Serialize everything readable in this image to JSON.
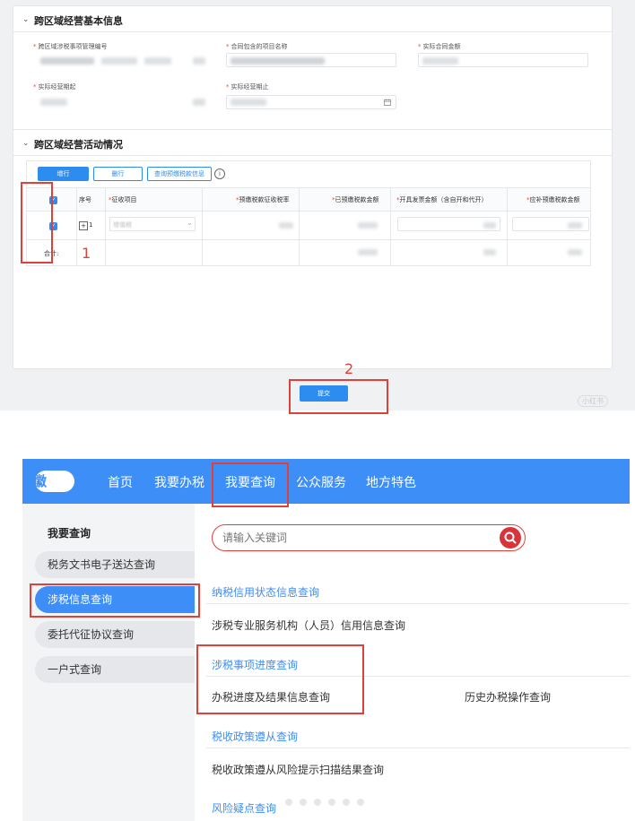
{
  "form": {
    "section1_title": "跨区域经营基本信息",
    "fields": [
      {
        "label": "跨区域涉税事项管理编号",
        "required": true
      },
      {
        "label": "合同包含的项目名称",
        "required": true
      },
      {
        "label": "实际合同金额",
        "required": true
      },
      {
        "label": "实际经营期起",
        "required": true
      },
      {
        "label": "实际经营期止",
        "required": true
      }
    ],
    "section2_title": "跨区域经营活动情况",
    "toolbar": {
      "add_row": "增行",
      "delete_row": "删行",
      "query_prepaid": "查询预缴税款信息"
    },
    "table": {
      "headers": [
        "序号",
        "征收项目",
        "预缴税款征收税率",
        "已预缴税款金额",
        "开具发票金额（含自开和代开）",
        "应补预缴税款金额"
      ],
      "row1": {
        "index": "1",
        "item_placeholder": "增值税"
      },
      "total_label": "合计:"
    },
    "submit": "提交",
    "annotation_1": "1",
    "annotation_2": "2",
    "watermark": "小红书"
  },
  "portal": {
    "logo": "徽",
    "nav": [
      "首页",
      "我要办税",
      "我要查询",
      "公众服务",
      "地方特色"
    ],
    "side_title": "我要查询",
    "side_items": [
      "税务文书电子送达查询",
      "涉税信息查询",
      "委托代征协议查询",
      "一户式查询"
    ],
    "active_side_item": "涉税信息查询",
    "search_placeholder": "请输入关键词",
    "groups": [
      {
        "title": "纳税信用状态信息查询",
        "items": [
          "涉税专业服务机构（人员）信用信息查询"
        ]
      },
      {
        "title": "涉税事项进度查询",
        "items": [
          "办税进度及结果信息查询",
          "历史办税操作查询"
        ]
      },
      {
        "title": "税收政策遵从查询",
        "items": [
          "税收政策遵从风险提示扫描结果查询"
        ]
      },
      {
        "title": "风险疑点查询",
        "items": []
      }
    ]
  },
  "colors": {
    "primary": "#2d8cf0",
    "nav": "#3e8ef7",
    "highlight": "#e0403a"
  }
}
